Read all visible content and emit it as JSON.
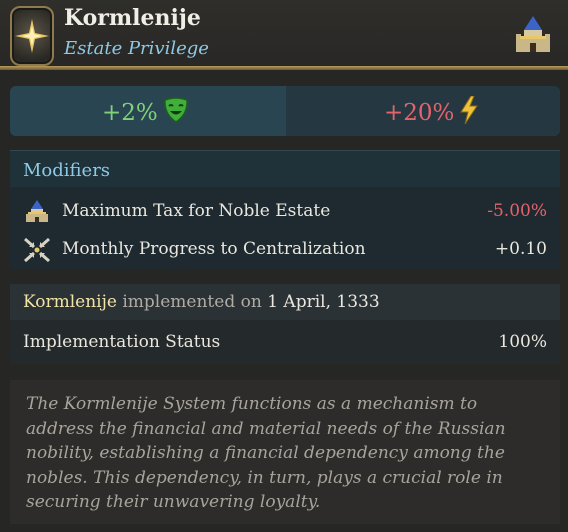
{
  "header": {
    "title": "Kormlenije",
    "subtitle": "Estate Privilege",
    "emblem_icon": "compass-star-icon",
    "estate_icon": "noble-castle-icon"
  },
  "effects": {
    "left_value": "+2%",
    "left_icon": "happy-mask-icon",
    "right_value": "+20%",
    "right_icon": "lightning-icon"
  },
  "modifiers": {
    "title": "Modifiers",
    "rows": [
      {
        "label": "Maximum Tax for Noble Estate",
        "value": "-5.00%",
        "icon": "noble-castle-icon"
      },
      {
        "label": "Monthly Progress to Centralization",
        "value": "+0.10",
        "icon": "centralization-arrows-icon"
      }
    ]
  },
  "implementation": {
    "name": "Kormlenije",
    "text": "implemented on",
    "date": "1 April, 1333",
    "status_label": "Implementation Status",
    "status_value": "100%"
  },
  "description": "The Kormlenije System functions as a mechanism to address the financial and material needs of the Russian nobility, establishing a financial dependency among the nobles. This dependency, in turn, plays a crucial role in securing their unwavering loyalty.",
  "colors": {
    "positive": "#7fd17a",
    "negative": "#e4636b",
    "accent": "#8ec9e6",
    "highlight": "#f2e3a6"
  }
}
